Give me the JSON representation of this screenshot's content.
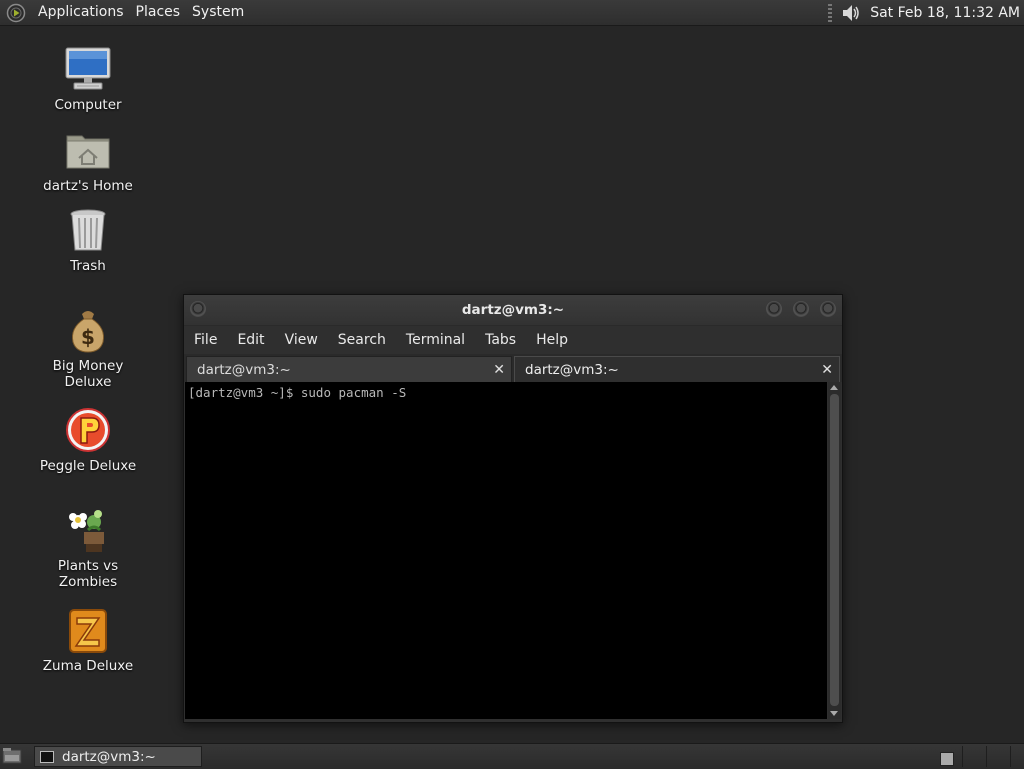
{
  "top_panel": {
    "menus": [
      "Applications",
      "Places",
      "System"
    ],
    "clock": "Sat Feb 18, 11:32 AM"
  },
  "desktop_icons": [
    {
      "label": "Computer",
      "icon": "computer-icon"
    },
    {
      "label": "dartz's Home",
      "icon": "home-folder-icon"
    },
    {
      "label": "Trash",
      "icon": "trash-icon"
    },
    {
      "label": "Big Money Deluxe",
      "icon": "money-bag-icon"
    },
    {
      "label": "Peggle Deluxe",
      "icon": "peggle-icon"
    },
    {
      "label": "Plants vs Zombies",
      "icon": "plants-vs-zombies-icon"
    },
    {
      "label": "Zuma Deluxe",
      "icon": "zuma-icon"
    }
  ],
  "terminal": {
    "title": "dartz@vm3:~",
    "menus": [
      "File",
      "Edit",
      "View",
      "Search",
      "Terminal",
      "Tabs",
      "Help"
    ],
    "tabs": [
      {
        "label": "dartz@vm3:~",
        "active": false
      },
      {
        "label": "dartz@vm3:~",
        "active": true
      }
    ],
    "close_glyph": "✕",
    "lines": [
      "[dartz@vm3 ~]$ sudo pacman -S"
    ]
  },
  "taskbar": {
    "tasks": [
      {
        "label": "dartz@vm3:~"
      }
    ]
  }
}
